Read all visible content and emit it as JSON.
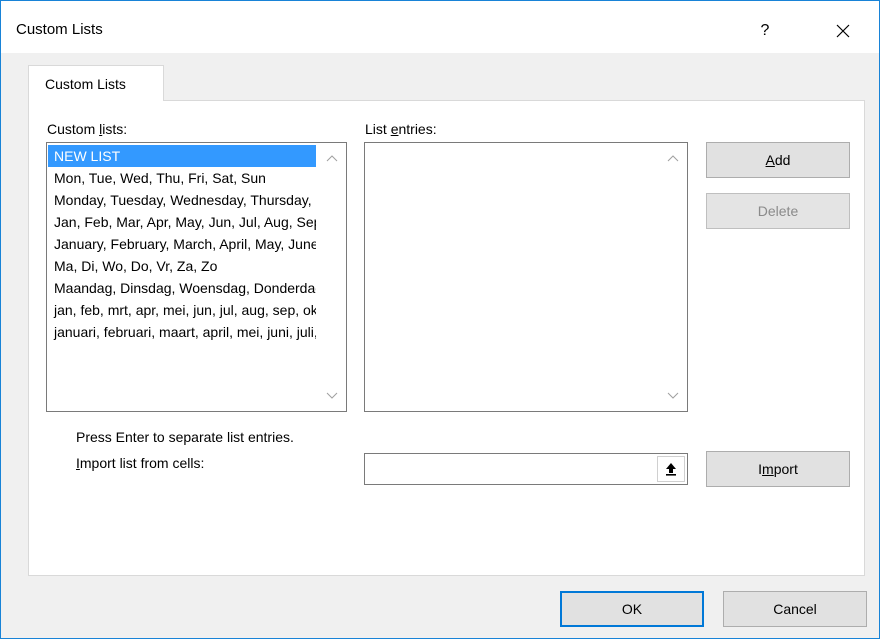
{
  "window": {
    "title": "Custom Lists",
    "help_label": "?",
    "accent_color": "#1883d7"
  },
  "tab": {
    "label": "Custom Lists"
  },
  "custom_lists": {
    "label_pre": "Custom ",
    "label_underlined": "l",
    "label_post": "ists:",
    "items": [
      "NEW LIST",
      "Mon, Tue, Wed, Thu, Fri, Sat, Sun",
      "Monday, Tuesday, Wednesday, Thursday, Friday, Saturday, Sunday",
      "Jan, Feb, Mar, Apr, May, Jun, Jul, Aug, Sep, Oct, Nov, Dec",
      "January, February, March, April, May, June, July, August, September, October, November, December",
      "Ma, Di, Wo, Do, Vr, Za, Zo",
      "Maandag, Dinsdag, Woensdag, Donderdag, Vrijdag, Zaterdag, Zondag",
      "jan, feb, mrt, apr, mei, jun, jul, aug, sep, okt, nov, dec",
      "januari, februari, maart, april, mei, juni, juli, augustus, september, oktober, november, december"
    ],
    "selected_index": 0,
    "selection_color": "#3399ff"
  },
  "list_entries": {
    "label_pre": "List ",
    "label_underlined": "e",
    "label_post": "ntries:",
    "value": ""
  },
  "buttons": {
    "add_underlined": "A",
    "add_rest": "dd",
    "delete": "Delete",
    "import_pre": "I",
    "import_underlined": "m",
    "import_post": "port",
    "ok": "OK",
    "cancel": "Cancel"
  },
  "hint": "Press Enter to separate list entries.",
  "import_from_cells": {
    "label_underlined": "I",
    "label_rest": "mport list from cells:",
    "value": ""
  }
}
